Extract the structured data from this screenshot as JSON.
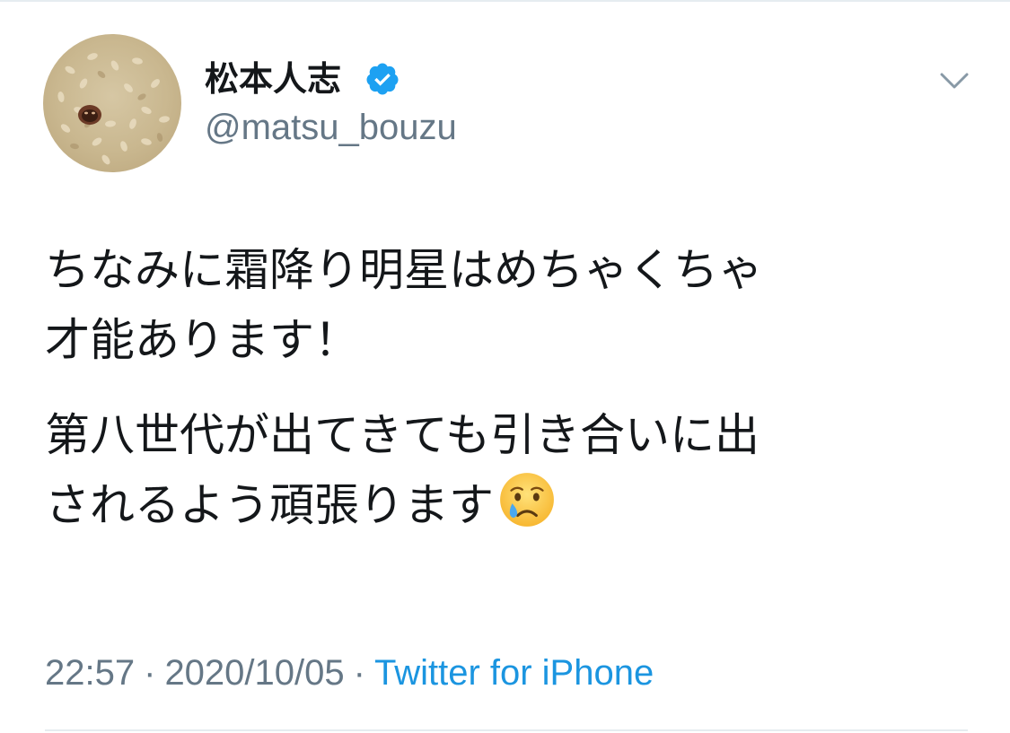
{
  "tweet": {
    "author": {
      "display_name": "松本人志",
      "handle": "@matsu_bouzu",
      "verified": true,
      "avatar_icon": "profile-photo"
    },
    "text_paragraphs": [
      {
        "lines": [
          "ちなみに霜降り明星はめちゃくちゃ",
          "才能あります！"
        ]
      },
      {
        "lines": [
          "第八世代が出てきても引き合いに出",
          "されるよう頑張ります"
        ],
        "trailing_emoji": "crying-face"
      }
    ],
    "time": "22:57",
    "date": "2020/10/05",
    "separator": "·",
    "source": "Twitter for iPhone",
    "menu_icon": "chevron-down-icon"
  },
  "colors": {
    "primary_text": "#14171a",
    "secondary_text": "#657786",
    "link": "#1b95e0",
    "verified_badge": "#1da1f2",
    "divider": "#e6ecf0"
  }
}
